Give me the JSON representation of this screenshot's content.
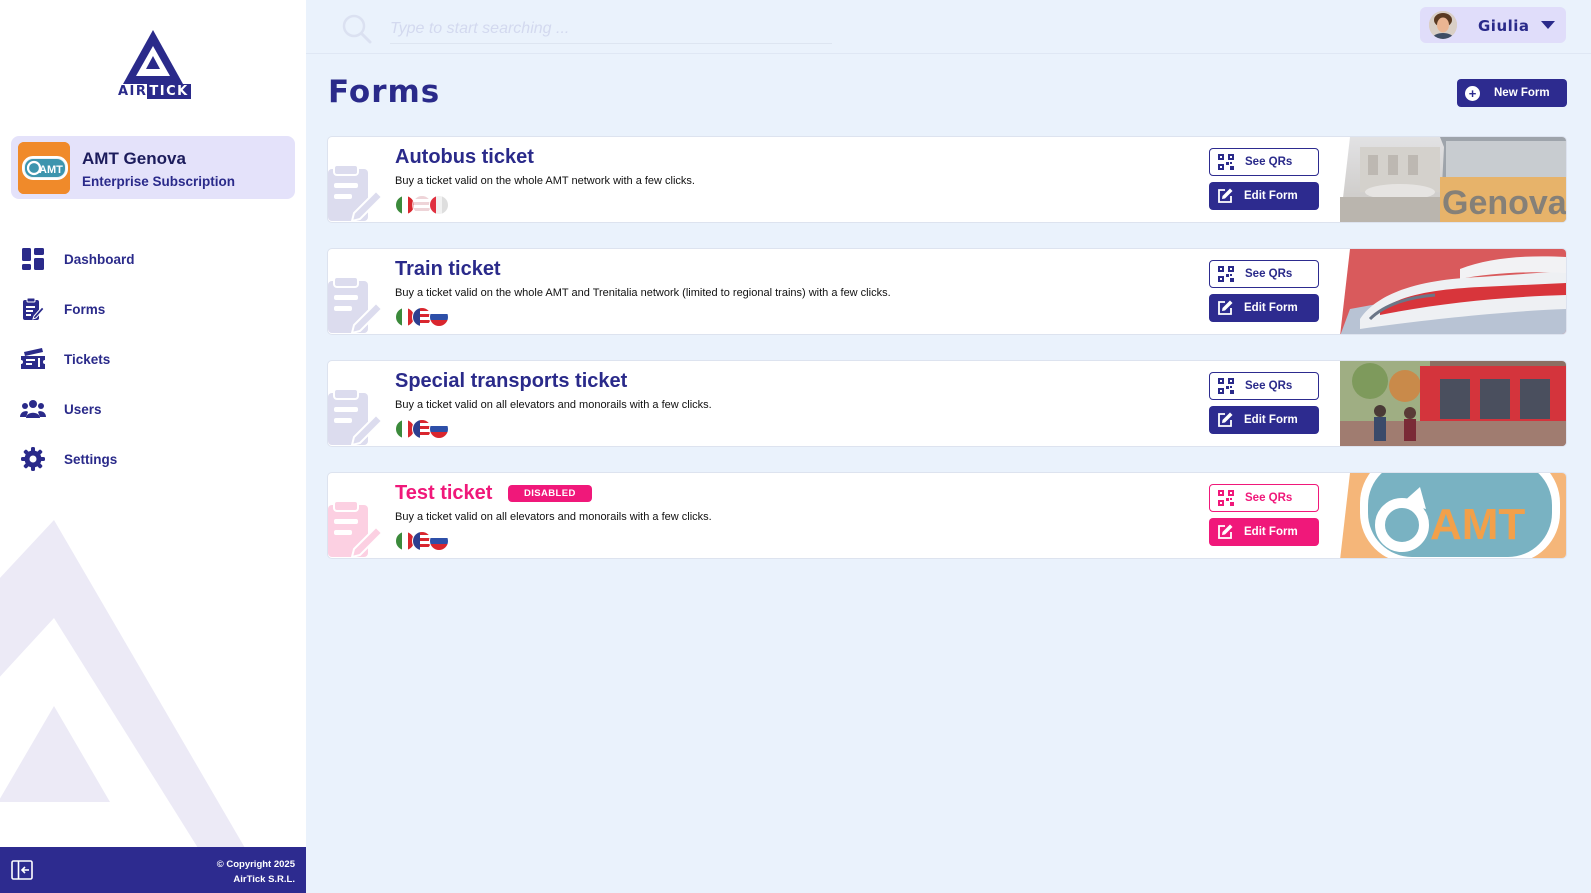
{
  "brand": {
    "logo_text_a": "AIR",
    "logo_text_b": "TICK"
  },
  "organization": {
    "name": "AMT Genova",
    "plan": "Enterprise Subscription",
    "logo_text": "AMT"
  },
  "nav": [
    {
      "label": "Dashboard",
      "icon": "dashboard-icon"
    },
    {
      "label": "Forms",
      "icon": "forms-icon"
    },
    {
      "label": "Tickets",
      "icon": "tickets-icon"
    },
    {
      "label": "Users",
      "icon": "users-icon"
    },
    {
      "label": "Settings",
      "icon": "gear-icon"
    }
  ],
  "footer": {
    "copyright_line1": "© Copyright 2025",
    "copyright_line2": "AirTick S.R.L."
  },
  "search": {
    "placeholder": "Type to start searching ..."
  },
  "user": {
    "name": "Giulia"
  },
  "page": {
    "title": "Forms",
    "new_form_label": "New Form"
  },
  "forms": [
    {
      "title": "Autobus ticket",
      "description": "Buy a ticket valid on the whole AMT network with a few clicks.",
      "badge": "",
      "flags": [
        "italy",
        "usa",
        "italy-faded"
      ],
      "see_qrs": "See QRs",
      "edit": "Edit Form"
    },
    {
      "title": "Train ticket",
      "description": "Buy a ticket valid on the whole AMT and Trenitalia network (limited to regional trains) with a few clicks.",
      "badge": "",
      "flags": [
        "italy",
        "usa",
        "slovenia"
      ],
      "see_qrs": "See QRs",
      "edit": "Edit Form"
    },
    {
      "title": "Special transports ticket",
      "description": "Buy a ticket valid on all elevators and monorails with a few clicks.",
      "badge": "",
      "flags": [
        "italy",
        "usa",
        "slovenia"
      ],
      "see_qrs": "See QRs",
      "edit": "Edit Form"
    },
    {
      "title": "Test ticket",
      "description": "Buy a ticket valid on all elevators and monorails with a few clicks.",
      "badge": "DISABLED",
      "flags": [
        "italy",
        "usa",
        "slovenia"
      ],
      "see_qrs": "See QRs",
      "edit": "Edit Form"
    }
  ],
  "colors": {
    "primary": "#2d2b8f",
    "accent_disabled": "#f0187a",
    "background": "#eaf2fc"
  }
}
